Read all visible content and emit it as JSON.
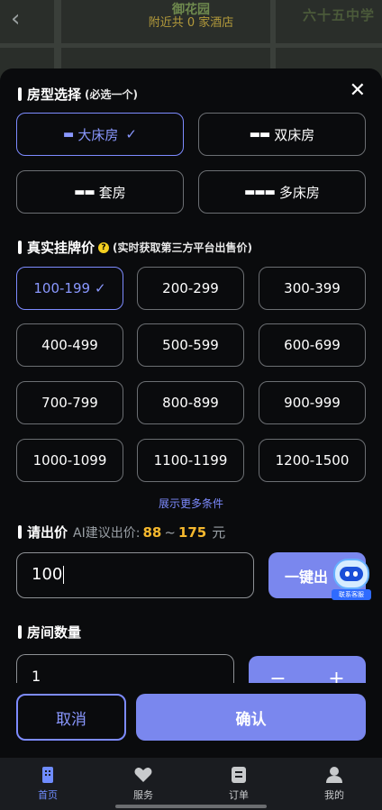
{
  "map": {
    "place_name": "御花园",
    "nearby_text": "附近共 0 家酒店",
    "school_label": "六十五中学"
  },
  "room_type": {
    "title": "房型选择",
    "hint": "(必选一个)",
    "options": [
      {
        "label": "大床房",
        "icon": "bed-single-icon",
        "selected": true
      },
      {
        "label": "双床房",
        "icon": "bed-double-icon",
        "selected": false
      },
      {
        "label": "套房",
        "icon": "suite-icon",
        "selected": false
      },
      {
        "label": "多床房",
        "icon": "bed-multi-icon",
        "selected": false
      }
    ]
  },
  "price": {
    "title": "真实挂牌价",
    "hint": "(实时获取第三方平台出售价)",
    "ranges": [
      "100-199",
      "200-299",
      "300-399",
      "400-499",
      "500-599",
      "600-699",
      "700-799",
      "800-899",
      "900-999",
      "1000-1099",
      "1100-1199",
      "1200-1500"
    ],
    "selected": "100-199",
    "more_label": "展示更多条件"
  },
  "bid": {
    "title": "请出价",
    "ai_label": "AI建议出价:",
    "min": "88",
    "tilde": "~",
    "max": "175",
    "unit": "元",
    "value": "100",
    "one_click_label": "一键出",
    "robot_label": "联系客服"
  },
  "rooms": {
    "title": "房间数量",
    "value": "1",
    "minus": "−",
    "plus": "+"
  },
  "actions": {
    "cancel": "取消",
    "confirm": "确认"
  },
  "tabs": [
    {
      "label": "首页",
      "icon": "home-icon",
      "active": true
    },
    {
      "label": "服务",
      "icon": "heart-icon",
      "active": false
    },
    {
      "label": "订单",
      "icon": "order-icon",
      "active": false
    },
    {
      "label": "我的",
      "icon": "profile-icon",
      "active": false
    }
  ],
  "colors": {
    "accent": "#7a87ee",
    "accent_text": "#8a98ff",
    "price_highlight": "#f5b82e"
  }
}
